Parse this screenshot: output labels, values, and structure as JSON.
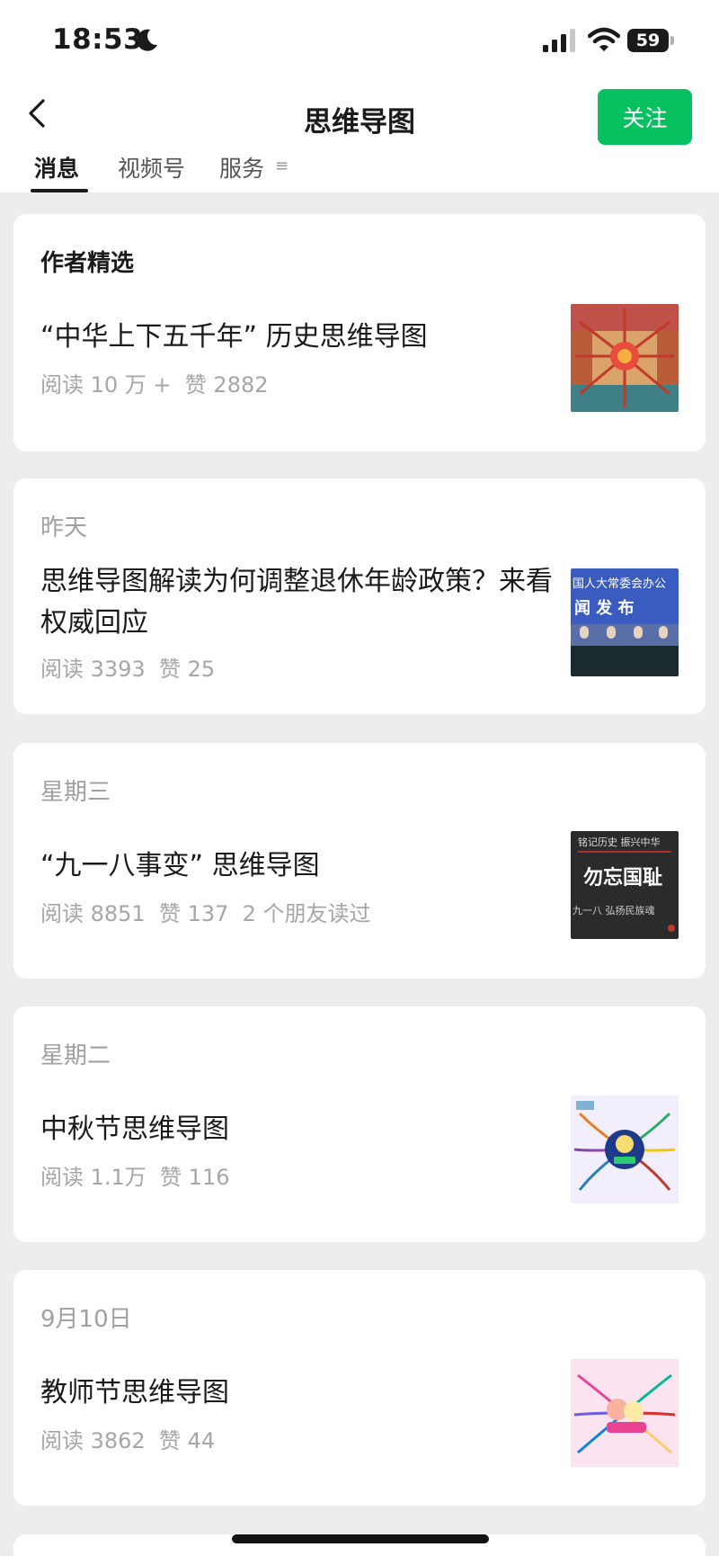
{
  "status": {
    "time": "18:53",
    "battery": "59",
    "icons": [
      "moon-icon",
      "signal-icon",
      "wifi-icon",
      "battery-icon"
    ]
  },
  "nav": {
    "back_icon": "back-chevron-icon",
    "title": "思维导图",
    "follow_label": "关注",
    "accent_color": "#07c160"
  },
  "tabs": [
    {
      "label": "消息",
      "active": true
    },
    {
      "label": "视频号",
      "active": false
    },
    {
      "label": "服务",
      "active": false
    }
  ],
  "tab_menu_glyph": "≡",
  "cards": [
    {
      "heading": "作者精选",
      "title": "“中华上下五千年” 历史思维导图",
      "meta": "阅读 10 万 +  赞 2882",
      "thumb_icon": "history-map-thumbnail"
    },
    {
      "heading": "昨天",
      "title": "思维导图解读为何调整退休年龄政策？来看权威回应",
      "meta": "阅读 3393  赞 25",
      "thumb_icon": "press-conference-thumbnail",
      "thumb_text": [
        "国人大常委会办公",
        "闻 发 布"
      ]
    },
    {
      "heading": "星期三",
      "title": "“九一八事变” 思维导图",
      "meta": "阅读 8851  赞 137  2 个朋友读过",
      "thumb_icon": "remember-history-thumbnail",
      "thumb_text": [
        "铭记历史 振兴中华",
        "勿忘国耻",
        "九一八  弘扬民族魂"
      ]
    },
    {
      "heading": "星期二",
      "title": "中秋节思维导图",
      "meta": "阅读 1.1万  赞 116",
      "thumb_icon": "mid-autumn-mindmap-thumbnail"
    },
    {
      "heading": "9月10日",
      "title": "教师节思维导图",
      "meta": "阅读 3862  赞 44",
      "thumb_icon": "teachers-day-mindmap-thumbnail"
    }
  ]
}
